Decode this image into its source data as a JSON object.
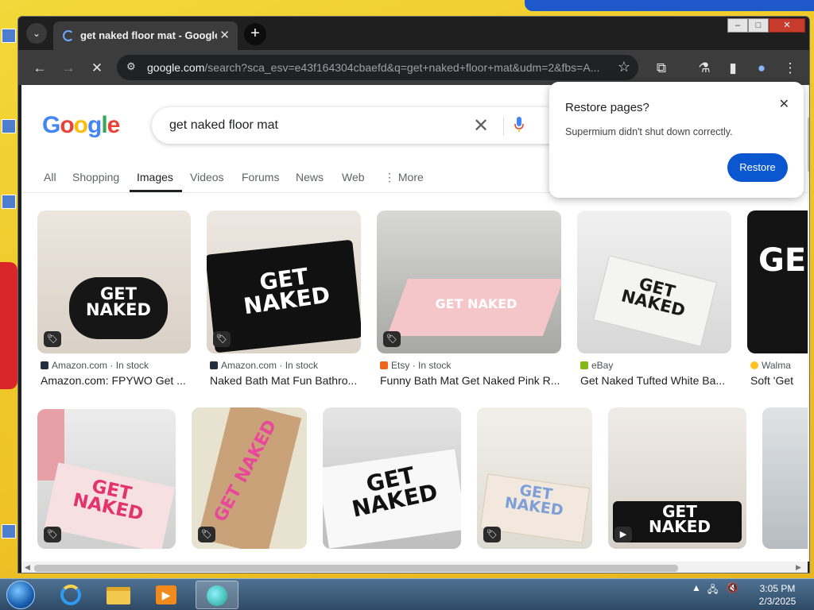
{
  "browser": {
    "tab_title": "get naked floor mat - Google S",
    "url_host": "google.com",
    "url_path": "/search?sca_esv=e43f164304cbaefd&q=get+naked+floor+mat&udm=2&fbs=A...",
    "window_controls": [
      "–",
      "□",
      "✕"
    ]
  },
  "google": {
    "logo_letters": [
      "G",
      "o",
      "o",
      "g",
      "l",
      "e"
    ],
    "logo_colors": [
      "#4285F4",
      "#EA4335",
      "#FBBC05",
      "#4285F4",
      "#34A853",
      "#EA4335"
    ],
    "query": "get naked floor mat",
    "tabs": [
      "All",
      "Shopping",
      "Images",
      "Videos",
      "Forums",
      "News",
      "Web",
      "More"
    ],
    "active_tab": "Images"
  },
  "results_row1": [
    {
      "source": "Amazon.com",
      "status": "In stock",
      "caption": "Amazon.com: FPYWO Get ...",
      "mat_text": "GET\nNAKED"
    },
    {
      "source": "Amazon.com",
      "status": "In stock",
      "caption": "Naked Bath Mat Fun Bathro...",
      "mat_text": "GET\nNAKED"
    },
    {
      "source": "Etsy",
      "status": "In stock",
      "caption": "Funny Bath Mat Get Naked Pink R...",
      "mat_text": "GET NAKED"
    },
    {
      "source": "eBay",
      "status": "",
      "caption": "Get Naked Tufted White Ba...",
      "mat_text": "GET\nNAKED"
    },
    {
      "source": "Walma",
      "status": "",
      "caption": "Soft 'Get",
      "mat_text": "GE"
    }
  ],
  "results_row2": [
    {
      "mat_text": "GET\nNAKED"
    },
    {
      "mat_text": "GET NAKED"
    },
    {
      "mat_text": "GET\nNAKED"
    },
    {
      "mat_text": "GET\nNAKED"
    },
    {
      "mat_text": "GET\nNAKED"
    },
    {
      "mat_text": ""
    }
  ],
  "popup": {
    "title": "Restore pages?",
    "message": "Supermium didn't shut down correctly.",
    "button": "Restore"
  },
  "taskbar": {
    "time": "3:05 PM",
    "date": "2/3/2025"
  }
}
